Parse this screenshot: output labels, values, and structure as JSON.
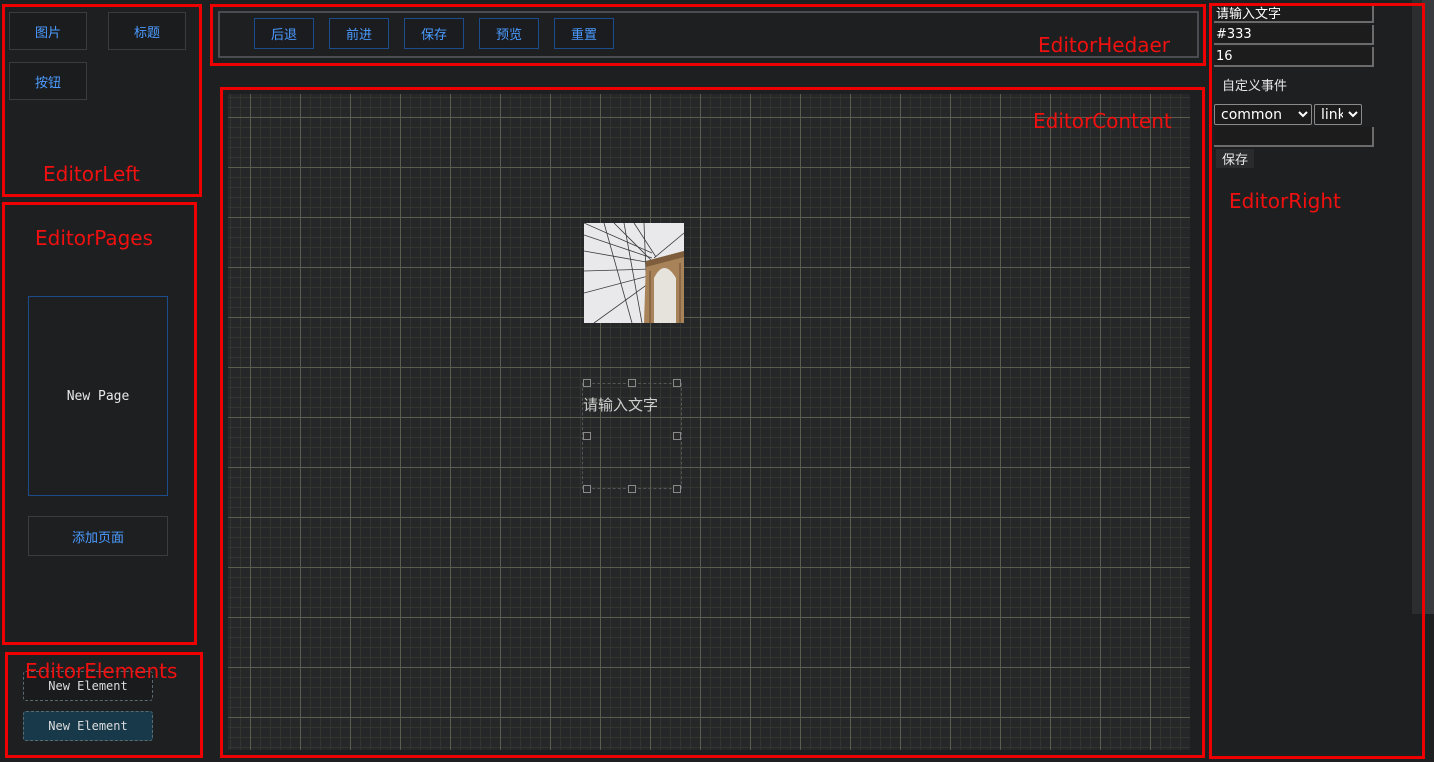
{
  "left_tools": [
    {
      "label": "图片"
    },
    {
      "label": "标题"
    },
    {
      "label": "按钮"
    }
  ],
  "header": {
    "buttons": [
      {
        "label": "后退"
      },
      {
        "label": "前进"
      },
      {
        "label": "保存"
      },
      {
        "label": "预览"
      },
      {
        "label": "重置"
      }
    ]
  },
  "pages": {
    "items": [
      {
        "label": "New Page"
      }
    ],
    "add_label": "添加页面"
  },
  "elements": [
    {
      "label": "New Element"
    },
    {
      "label": "New Element"
    }
  ],
  "canvas": {
    "text_element": "请输入文字"
  },
  "right_panel": {
    "text_value": "请输入文字",
    "color_value": "#333",
    "font_size_value": "16",
    "custom_event_label": "自定义事件",
    "event_type_selected": "common",
    "event_action_selected": "link",
    "event_param_value": "",
    "save_label": "保存"
  },
  "annotations": {
    "editor_left": "EditorLeft",
    "editor_pages": "EditorPages",
    "editor_elements": "EditorElements",
    "editor_header": "EditorHedaer",
    "editor_content": "EditorContent",
    "editor_right": "EditorRight"
  },
  "colors": {
    "annotation_red": "#ee0000",
    "accent_blue": "#4b9bff",
    "background": "#1e1f21"
  }
}
